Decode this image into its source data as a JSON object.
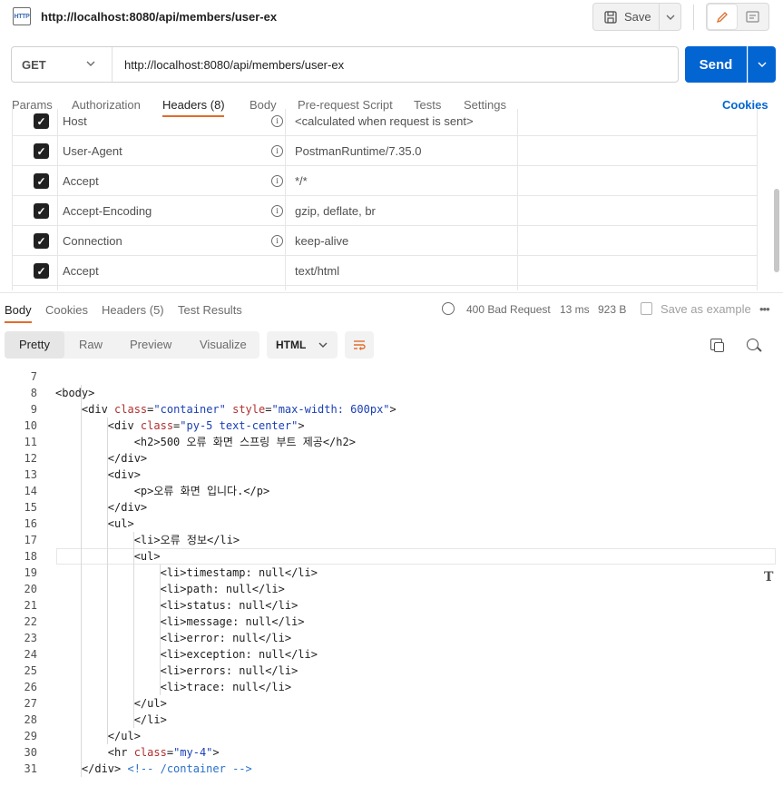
{
  "tab": {
    "title": "http://localhost:8080/api/members/user-ex",
    "icon": "http-icon",
    "icon_text": "HTTP"
  },
  "toolbar": {
    "save_label": "Save"
  },
  "request": {
    "method": "GET",
    "url": "http://localhost:8080/api/members/user-ex",
    "send_label": "Send"
  },
  "request_tabs": [
    "Params",
    "Authorization",
    "Headers (8)",
    "Body",
    "Pre-request Script",
    "Tests",
    "Settings"
  ],
  "request_tabs_active": "Headers (8)",
  "cookies_label": "Cookies",
  "headers": [
    {
      "key": "Host",
      "value": "<calculated when request is sent>",
      "info": true
    },
    {
      "key": "User-Agent",
      "value": "PostmanRuntime/7.35.0",
      "info": true
    },
    {
      "key": "Accept",
      "value": "*/*",
      "info": true
    },
    {
      "key": "Accept-Encoding",
      "value": "gzip, deflate, br",
      "info": true
    },
    {
      "key": "Connection",
      "value": "keep-alive",
      "info": true
    },
    {
      "key": "Accept",
      "value": "text/html",
      "info": false
    }
  ],
  "response_tabs": [
    "Body",
    "Cookies",
    "Headers (5)",
    "Test Results"
  ],
  "response_tabs_active": "Body",
  "response_status": {
    "status": "400 Bad Request",
    "time": "13 ms",
    "size": "923 B",
    "save_example": "Save as example"
  },
  "view_tabs": [
    "Pretty",
    "Raw",
    "Preview",
    "Visualize"
  ],
  "view_active": "Pretty",
  "format": "HTML",
  "colors": {
    "accent": "#e06c2b",
    "send": "#0265d2",
    "link": "#0265d2",
    "attr": "#b03030",
    "string": "#1a3fb5"
  },
  "code_lines": [
    {
      "n": "7",
      "parts": []
    },
    {
      "n": "8",
      "parts": [
        [
          "tag",
          "<body>"
        ]
      ]
    },
    {
      "n": "9",
      "parts": [
        [
          "tag",
          "    <div "
        ],
        [
          "attr",
          "class"
        ],
        [
          "tag",
          "="
        ],
        [
          "str",
          "\"container\""
        ],
        [
          "tag",
          " "
        ],
        [
          "attr",
          "style"
        ],
        [
          "tag",
          "="
        ],
        [
          "str",
          "\"max-width: 600px\""
        ],
        [
          "tag",
          ">"
        ]
      ]
    },
    {
      "n": "10",
      "parts": [
        [
          "tag",
          "        <div "
        ],
        [
          "attr",
          "class"
        ],
        [
          "tag",
          "="
        ],
        [
          "str",
          "\"py-5 text-center\""
        ],
        [
          "tag",
          ">"
        ]
      ]
    },
    {
      "n": "11",
      "parts": [
        [
          "tag",
          "            <h2>500 오류 화면 스프링 부트 제공</h2>"
        ]
      ]
    },
    {
      "n": "12",
      "parts": [
        [
          "tag",
          "        </div>"
        ]
      ]
    },
    {
      "n": "13",
      "parts": [
        [
          "tag",
          "        <div>"
        ]
      ]
    },
    {
      "n": "14",
      "parts": [
        [
          "tag",
          "            <p>오류 화면 입니다.</p>"
        ]
      ]
    },
    {
      "n": "15",
      "parts": [
        [
          "tag",
          "        </div>"
        ]
      ]
    },
    {
      "n": "16",
      "parts": [
        [
          "tag",
          "        <ul>"
        ]
      ]
    },
    {
      "n": "17",
      "parts": [
        [
          "tag",
          "            <li>오류 정보</li>"
        ]
      ]
    },
    {
      "n": "18",
      "parts": [
        [
          "tag",
          "            <ul>"
        ]
      ]
    },
    {
      "n": "19",
      "parts": [
        [
          "tag",
          "                <li>timestamp: null</li>"
        ]
      ]
    },
    {
      "n": "20",
      "parts": [
        [
          "tag",
          "                <li>path: null</li>"
        ]
      ]
    },
    {
      "n": "21",
      "parts": [
        [
          "tag",
          "                <li>status: null</li>"
        ]
      ]
    },
    {
      "n": "22",
      "parts": [
        [
          "tag",
          "                <li>message: null</li>"
        ]
      ]
    },
    {
      "n": "23",
      "parts": [
        [
          "tag",
          "                <li>error: null</li>"
        ]
      ]
    },
    {
      "n": "24",
      "parts": [
        [
          "tag",
          "                <li>exception: null</li>"
        ]
      ]
    },
    {
      "n": "25",
      "parts": [
        [
          "tag",
          "                <li>errors: null</li>"
        ]
      ]
    },
    {
      "n": "26",
      "parts": [
        [
          "tag",
          "                <li>trace: null</li>"
        ]
      ]
    },
    {
      "n": "27",
      "parts": [
        [
          "tag",
          "            </ul>"
        ]
      ]
    },
    {
      "n": "28",
      "parts": [
        [
          "tag",
          "            </li>"
        ]
      ]
    },
    {
      "n": "29",
      "parts": [
        [
          "tag",
          "        </ul>"
        ]
      ]
    },
    {
      "n": "30",
      "parts": [
        [
          "tag",
          "        <hr "
        ],
        [
          "attr",
          "class"
        ],
        [
          "tag",
          "="
        ],
        [
          "str",
          "\"my-4\""
        ],
        [
          "tag",
          ">"
        ]
      ]
    },
    {
      "n": "31",
      "parts": [
        [
          "tag",
          "    </div> "
        ],
        [
          "cmt",
          "<!-- /container -->"
        ]
      ]
    }
  ]
}
